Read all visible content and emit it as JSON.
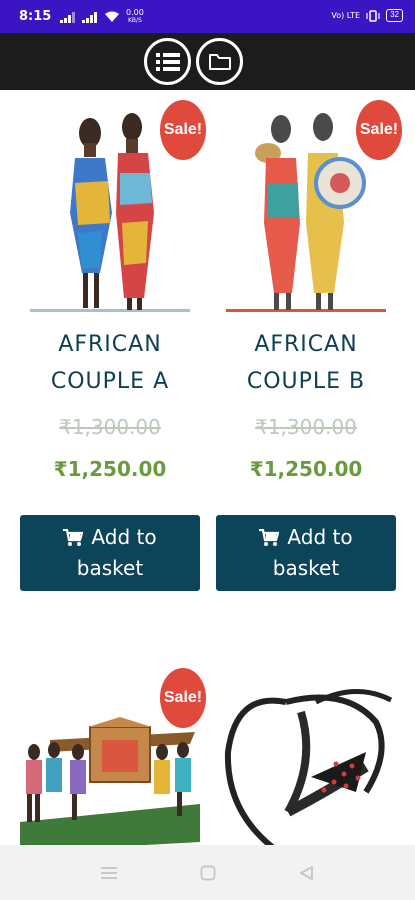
{
  "status_bar": {
    "time": "8:15",
    "data_speed": "0.00",
    "data_unit": "KB/S",
    "volte": "Vo) LTE",
    "battery": "32"
  },
  "header": {
    "list_icon": "list-icon",
    "folder_icon": "folder-icon"
  },
  "products": [
    {
      "name_line1": "AFRICAN",
      "name_line2": "COUPLE A",
      "old_price": "₹1,300.00",
      "price": "₹1,250.00",
      "badge": "Sale!",
      "button_line1": "Add to",
      "button_line2": "basket"
    },
    {
      "name_line1": "AFRICAN",
      "name_line2": "COUPLE B",
      "old_price": "₹1,300.00",
      "price": "₹1,250.00",
      "badge": "Sale!",
      "button_line1": "Add to",
      "button_line2": "basket"
    },
    {
      "badge": "Sale!"
    },
    {}
  ],
  "nav": {
    "menu_icon": "menu-icon",
    "home_icon": "home-icon",
    "back_icon": "back-icon"
  },
  "colors": {
    "status_bar": "#3b14c4",
    "header": "#1c1c1c",
    "sale_badge": "#e04a3c",
    "button": "#0c4459",
    "title": "#0e3f52",
    "price": "#6a9a3e",
    "old_price": "#bcc9b8"
  }
}
